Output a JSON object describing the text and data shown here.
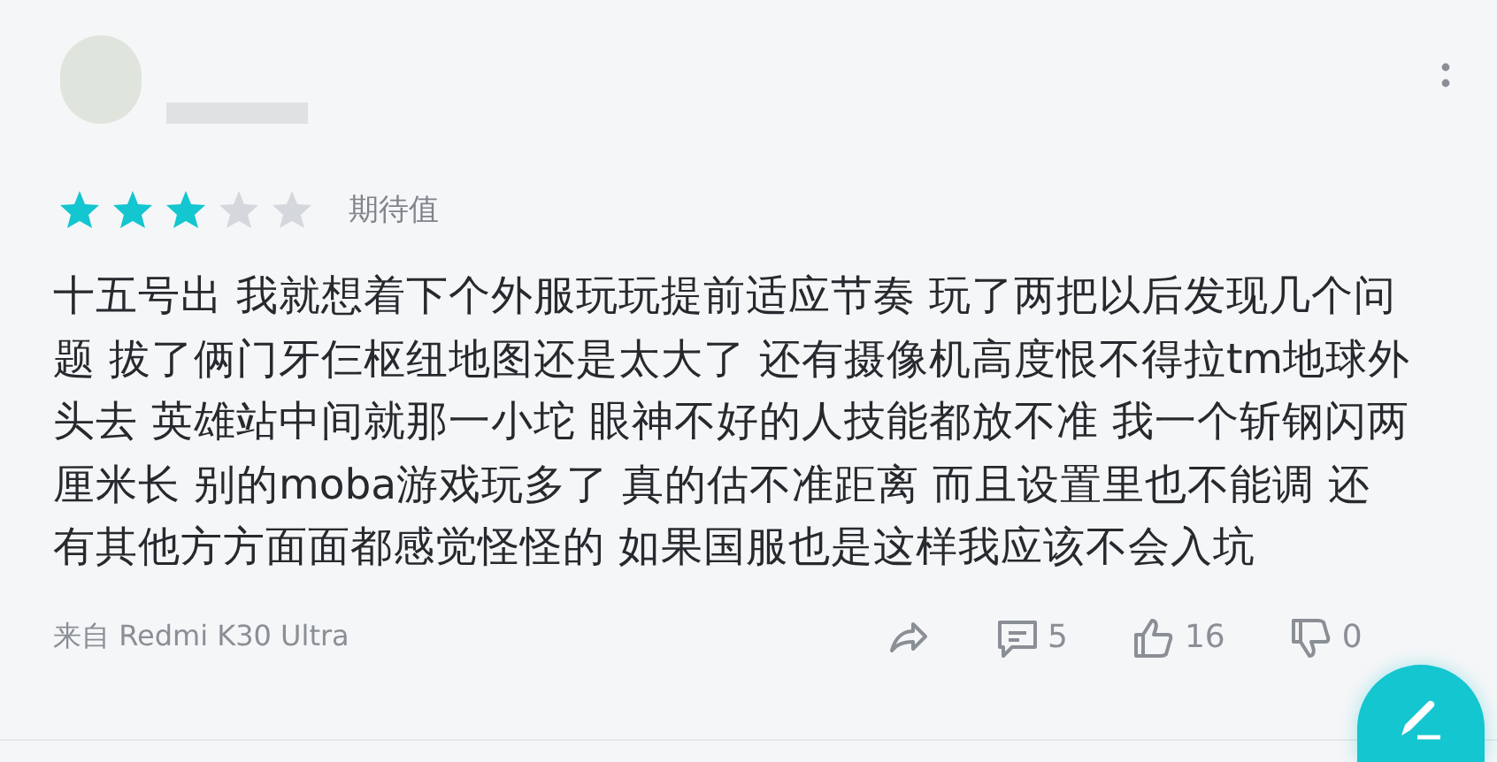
{
  "review": {
    "stars": 3,
    "rating_label": "期待值",
    "body": "十五号出 我就想着下个外服玩玩提前适应节奏 玩了两把以后发现几个问题 拔了俩门牙仨枢纽地图还是太大了 还有摄像机高度恨不得拉tm地球外头去 英雄站中间就那一小坨 眼神不好的人技能都放不准 我一个斩钢闪两厘米长 别的moba游戏玩多了 真的估不准距离 而且设置里也不能调 还有其他方方面面都感觉怪怪的 如果国服也是这样我应该不会入坑",
    "device": "来自 Redmi K30 Ultra",
    "actions": [
      {
        "kind": "share"
      },
      {
        "kind": "comment",
        "count": "5"
      },
      {
        "kind": "like",
        "count": "16"
      },
      {
        "kind": "dislike",
        "count": "0"
      }
    ]
  }
}
